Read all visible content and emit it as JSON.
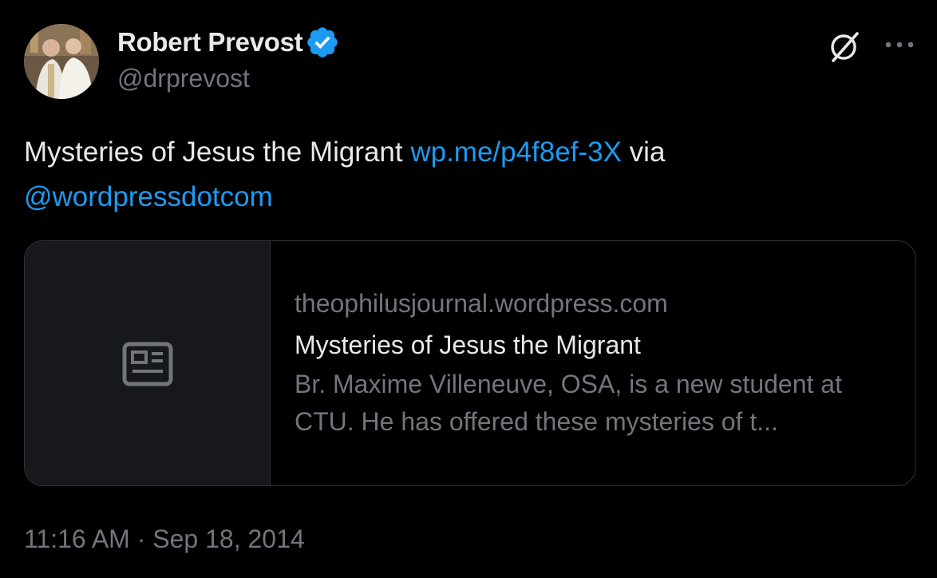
{
  "author": {
    "display_name": "Robert Prevost",
    "handle": "@drprevost",
    "verified": true,
    "verified_color": "#1d9bf0"
  },
  "icons": {
    "grok": "grok-icon",
    "more": "more-options-icon",
    "card_thumbnail": "newspaper-icon"
  },
  "tweet": {
    "text_before_link": "Mysteries of Jesus the Migrant ",
    "link_text": "wp.me/p4f8ef-3X",
    "text_after_link": " via",
    "mention": "@wordpressdotcom",
    "link_color": "#1d9bf0"
  },
  "card": {
    "domain": "theophilusjournal.wordpress.com",
    "title": "Mysteries of Jesus the Migrant",
    "description": "Br. Maxime Villeneuve, OSA, is a new student at CTU. He has offered these mysteries of t..."
  },
  "timestamp": "11:16 AM · Sep 18, 2014"
}
